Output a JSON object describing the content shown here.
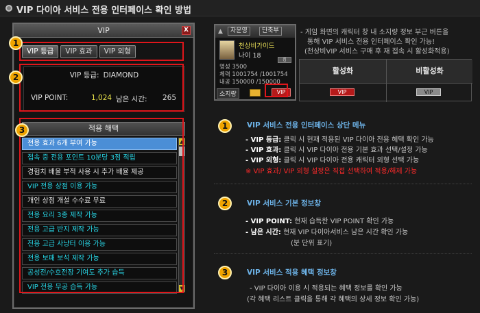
{
  "header": {
    "title": "VIP 다이아 서비스 전용 인터페이스 확인 방법"
  },
  "vip_window": {
    "title": "VIP",
    "close_label": "X",
    "tabs": [
      "VIP 등급",
      "VIP 효과",
      "VIP 외형"
    ],
    "grade_label": "VIP 등급:",
    "grade_value": "DIAMOND",
    "point_label": "VIP POINT:",
    "point_value": "1,024",
    "time_label": "남은 시간:",
    "time_value": "265",
    "benefits_header": "적용 해택",
    "benefits": [
      "전용 효과 6개 부여 가능",
      "접속 중 전용 포인트 10분당 3점 적립",
      "경험치 배율 부적 사용 시 추가 배율 제공",
      "VIP 전용 상점 이용 가능",
      "개인 상점 개설 수수료 무료",
      "전용 요리 3종 제작 가능",
      "전용 고급 반지 제작 가능",
      "전용 고급 사냥터 이용 가능",
      "전용 보패 보석 제작 가능",
      "공성전/수호전장 기여도 추가 습득",
      "VIP 전용 무공 습득 가능"
    ]
  },
  "badges": [
    "1",
    "2",
    "3"
  ],
  "character_panel": {
    "btn1": "자운영",
    "btn2": "단축부",
    "name": "천상비가이드",
    "level": "나이 18",
    "fame": "명성 3500",
    "stamina": "체력 1001754 /1001754",
    "durability": "내공  150000 /150000",
    "small_btn": "집",
    "own_label": "소지량",
    "vip_label": "VIP"
  },
  "notes": [
    "- 게임 화면의 캐릭터 창 내 소지량 정보 부근 버튼을",
    "통해 VIP 서비스 전용 인터페이스 확인 가능!",
    "(천상비VIP 서비스 구매 후 재 접속 시 활성화적용)"
  ],
  "activation": {
    "active_header": "활성화",
    "inactive_header": "비활성화",
    "active_btn": "VIP",
    "inactive_btn": "VIP"
  },
  "sections": [
    {
      "title": "VIP 서비스 전용 인터페이스 상단 메뉴",
      "lines": [
        {
          "bold": "- VIP 등급:",
          "text": " 클릭 시 현재 적용된 VIP 다이아 전용 혜택 확인 가능"
        },
        {
          "bold": "- VIP 효과:",
          "text": " 클릭 시 VIP 다이아 전용 기본 효과 선택/설정 가능"
        },
        {
          "bold": "- VIP 외형:",
          "text": " 클릭 시 VIP 다이아 전용 캐릭터 외형 선택 가능"
        }
      ],
      "warning": "※ VIP 효과/ VIP 외형 설정은 직접 선택하여 적용/해제 가능"
    },
    {
      "title": "VIP 서비스 기본 정보창",
      "lines": [
        {
          "bold": "- VIP POINT:",
          "text": " 현재 습득한 VIP POINT 확인 가능"
        },
        {
          "bold": "- 남은 시간:",
          "text": " 현재 VIP 다이아서비스 남은 시간 확인 가능"
        }
      ],
      "sub": "(분 단위 표기)"
    },
    {
      "title": "VIP 서비스 적용 혜택 정보창",
      "lines": [
        {
          "bold": "",
          "text": "- VIP 다이아 이용 시 적용되는 혜택 정보를 확인 가능"
        },
        {
          "bold": "",
          "text": "(각 혜택 리스트 클릭을 통해 각 혜택의 상세 정보 확인 가능)"
        }
      ]
    }
  ]
}
